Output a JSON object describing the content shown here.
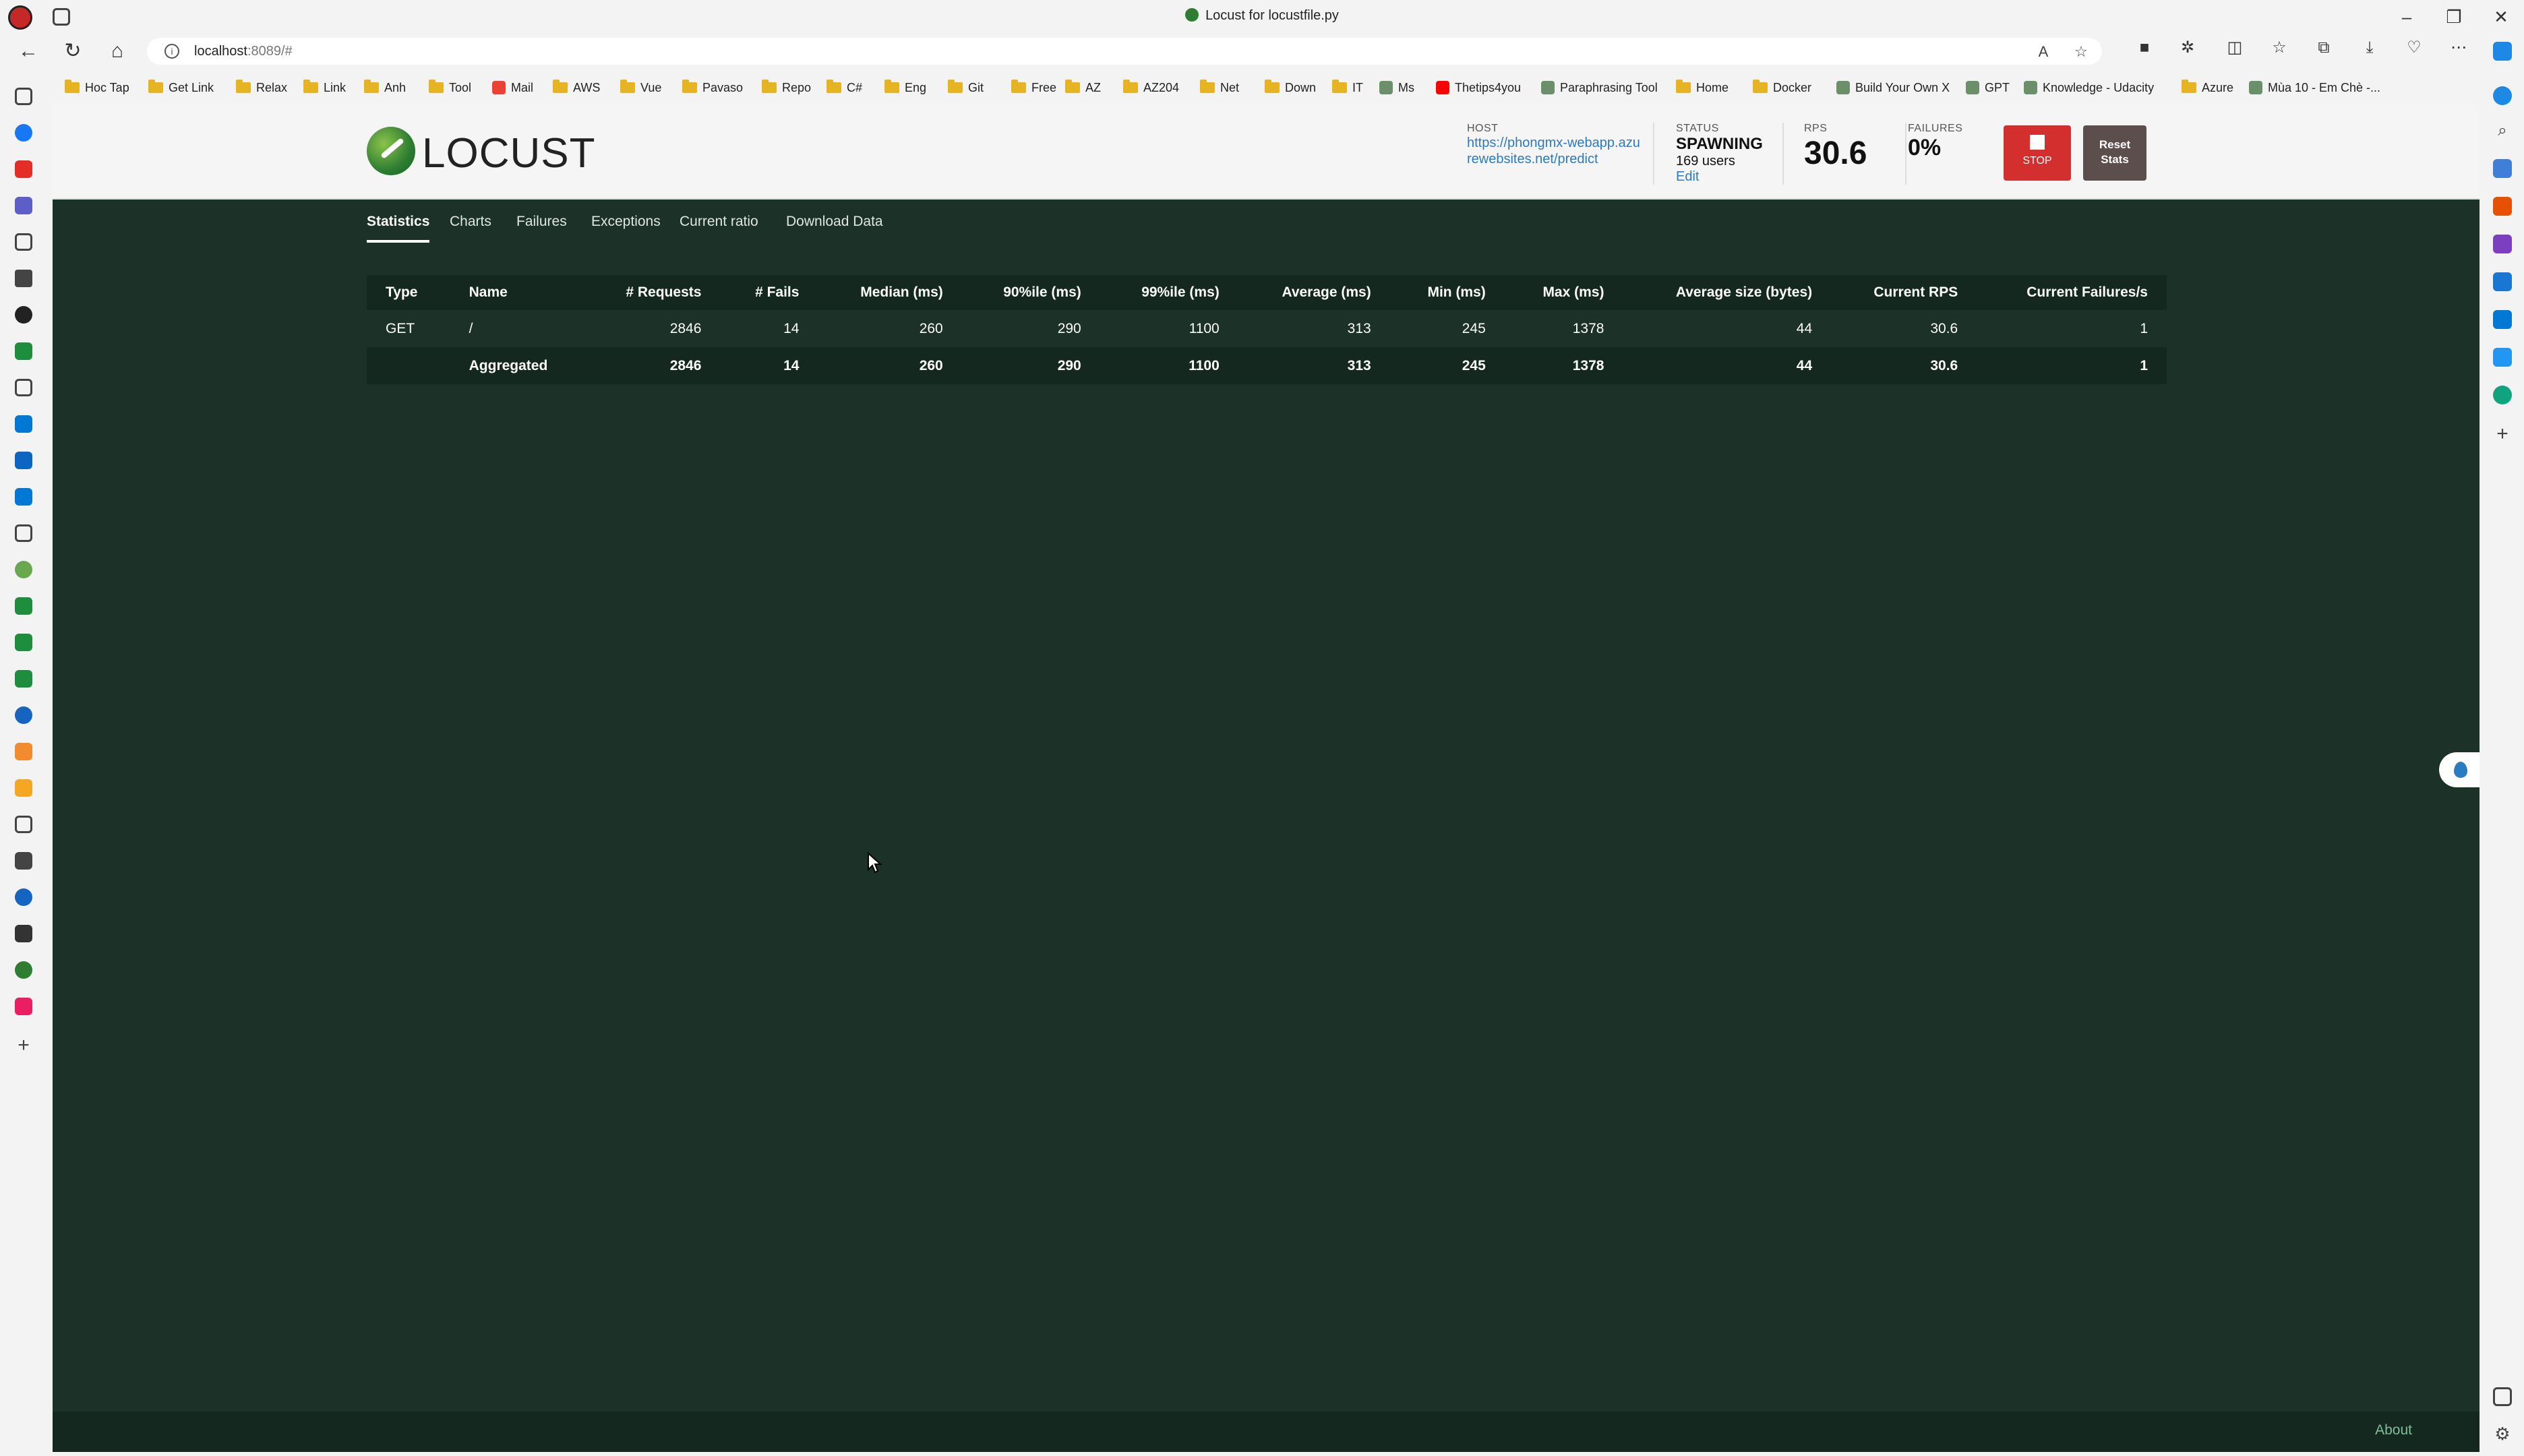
{
  "browser": {
    "tab_title": "Locust for locustfile.py",
    "url_host": "localhost",
    "url_rest": ":8089/#"
  },
  "bookmarks": [
    {
      "label": "Hoc Tap",
      "icon": "folder-icon"
    },
    {
      "label": "Get Link",
      "icon": "folder-icon"
    },
    {
      "label": "Relax",
      "icon": "folder-icon"
    },
    {
      "label": "Link",
      "icon": "folder-icon"
    },
    {
      "label": "Anh",
      "icon": "folder-icon"
    },
    {
      "label": "Tool",
      "icon": "folder-icon"
    },
    {
      "label": "Mail",
      "icon": "gmail-icon"
    },
    {
      "label": "AWS",
      "icon": "folder-icon"
    },
    {
      "label": "Vue",
      "icon": "folder-icon"
    },
    {
      "label": "Pavaso",
      "icon": "folder-icon"
    },
    {
      "label": "Repo",
      "icon": "folder-icon"
    },
    {
      "label": "C#",
      "icon": "folder-icon"
    },
    {
      "label": "Eng",
      "icon": "folder-icon"
    },
    {
      "label": "Git",
      "icon": "folder-icon"
    },
    {
      "label": "Free",
      "icon": "folder-icon"
    },
    {
      "label": "AZ",
      "icon": "folder-icon"
    },
    {
      "label": "AZ204",
      "icon": "folder-icon"
    },
    {
      "label": "Net",
      "icon": "folder-icon"
    },
    {
      "label": "Down",
      "icon": "folder-icon"
    },
    {
      "label": "IT",
      "icon": "folder-icon"
    },
    {
      "label": "Ms",
      "icon": "site-icon"
    },
    {
      "label": "Thetips4you",
      "icon": "youtube-icon"
    },
    {
      "label": "Paraphrasing Tool",
      "icon": "site-icon"
    },
    {
      "label": "Home",
      "icon": "folder-icon"
    },
    {
      "label": "Docker",
      "icon": "folder-icon"
    },
    {
      "label": "Build Your Own X",
      "icon": "site-icon"
    },
    {
      "label": "GPT",
      "icon": "site-icon"
    },
    {
      "label": "Knowledge - Udacity",
      "icon": "site-icon"
    },
    {
      "label": "Azure",
      "icon": "folder-icon"
    },
    {
      "label": "Mùa 10 - Em Chè -...",
      "icon": "site-icon"
    }
  ],
  "locust": {
    "logo_text": "LOCUST",
    "host_label": "HOST",
    "host_url": "https://phongmx-webapp.azurewebsites.net/predict",
    "status_label": "STATUS",
    "status_value": "SPAWNING",
    "users_text": "169 users",
    "edit_label": "Edit",
    "rps_label": "RPS",
    "rps_value": "30.6",
    "failures_label": "FAILURES",
    "failures_value": "0%",
    "stop_label": "STOP",
    "reset_label_1": "Reset",
    "reset_label_2": "Stats",
    "tabs": [
      "Statistics",
      "Charts",
      "Failures",
      "Exceptions",
      "Current ratio",
      "Download Data"
    ],
    "active_tab": "Statistics",
    "about_label": "About"
  },
  "table": {
    "headers": [
      "Type",
      "Name",
      "# Requests",
      "# Fails",
      "Median (ms)",
      "90%ile (ms)",
      "99%ile (ms)",
      "Average (ms)",
      "Min (ms)",
      "Max (ms)",
      "Average size (bytes)",
      "Current RPS",
      "Current Failures/s"
    ],
    "rows": [
      [
        "GET",
        "/",
        "2846",
        "14",
        "260",
        "290",
        "1100",
        "313",
        "245",
        "1378",
        "44",
        "30.6",
        "1"
      ],
      [
        "",
        "Aggregated",
        "2846",
        "14",
        "260",
        "290",
        "1100",
        "313",
        "245",
        "1378",
        "44",
        "30.6",
        "1"
      ]
    ]
  },
  "colors": {
    "page_bg": "#1c3128",
    "table_bg": "#15281f",
    "stop_red": "#d32f2f",
    "link_blue": "#2a7bbf"
  }
}
